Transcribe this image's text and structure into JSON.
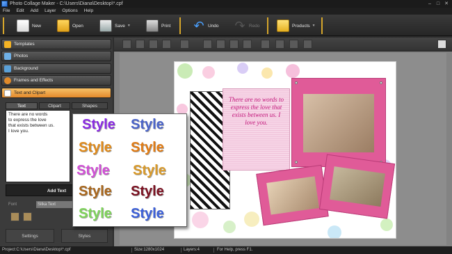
{
  "window": {
    "title": "Photo Collage Maker - C:\\Users\\Diana\\Desktop\\*.cpf",
    "minimize": "–",
    "maximize": "□",
    "close": "✕"
  },
  "menu": [
    "File",
    "Edit",
    "Add",
    "Layer",
    "Options",
    "Help"
  ],
  "toolbar": {
    "new": "New",
    "open": "Open",
    "save": "Save",
    "print": "Print",
    "undo": "Undo",
    "redo": "Redo",
    "products": "Products"
  },
  "sidebar": {
    "items": [
      {
        "label": "Templates",
        "icon": "star-icon"
      },
      {
        "label": "Photos",
        "icon": "photos-icon"
      },
      {
        "label": "Background",
        "icon": "background-icon"
      },
      {
        "label": "Frames and Effects",
        "icon": "frames-icon"
      },
      {
        "label": "Text and Clipart",
        "icon": "text-clipart-icon",
        "active": true
      }
    ],
    "subtabs": [
      "Text",
      "Clipart",
      "Shapes"
    ],
    "text_value": "There are no words\nto express the love\nthat exists between us.\nI love you.",
    "add_text": "Add Text",
    "font_label": "Font",
    "font_value": "Sitka Text",
    "bottom_tabs": [
      "Settings",
      "Styles"
    ]
  },
  "collage": {
    "quote": "There are no words to express the love that exists between us. I love you."
  },
  "styles": {
    "word": "Style",
    "items": [
      {
        "color": "#8a2be2"
      },
      {
        "color": "#4a63c8"
      },
      {
        "color": "#e08a1a"
      },
      {
        "color": "#e07b14"
      },
      {
        "color": "#d14fd6"
      },
      {
        "color": "#d99a2a"
      },
      {
        "color": "#a8661c"
      },
      {
        "color": "#7a1020"
      },
      {
        "color": "#7ed35a"
      },
      {
        "color": "#3b5fd8"
      }
    ]
  },
  "status": {
    "project": "Project:C:\\Users\\Diana\\Desktop\\*.cpf",
    "size": "Size:1280x1024",
    "layers": "Layers:4",
    "help": "For Help, press F1."
  }
}
